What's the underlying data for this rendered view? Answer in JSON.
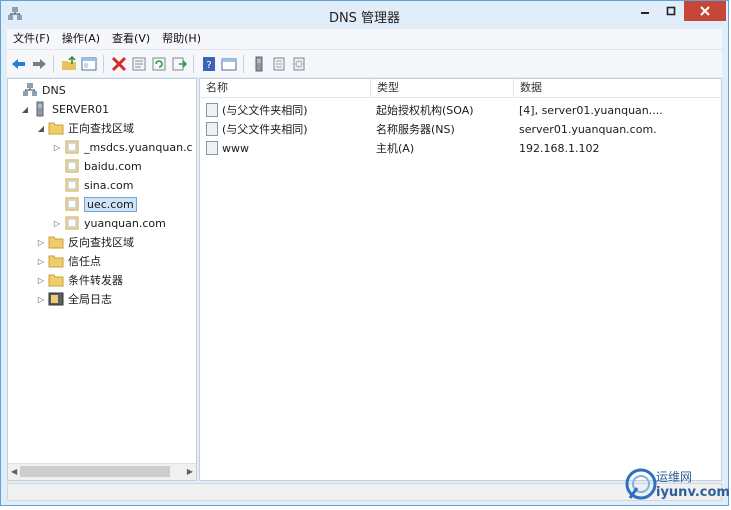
{
  "window": {
    "title": "DNS 管理器",
    "accent": "#c7463a"
  },
  "menu": [
    "文件(F)",
    "操作(A)",
    "查看(V)",
    "帮助(H)"
  ],
  "toolbar": {
    "icons": [
      "back-arrow-icon",
      "forward-arrow-icon",
      "up-folder-icon",
      "show-hide-tree-icon",
      "delete-icon",
      "properties-icon",
      "refresh-icon",
      "export-list-icon",
      "help-icon",
      "mmc-view-icon",
      "server-icon",
      "zone-record-icon",
      "doc-record-icon"
    ]
  },
  "tree": {
    "root": "DNS",
    "server": "SERVER01",
    "forward_zones": "正向查找区域",
    "zones": [
      "_msdcs.yuanquan.c",
      "baidu.com",
      "sina.com",
      "uec.com",
      "yuanquan.com"
    ],
    "selected": "uec.com",
    "reverse_zones": "反向查找区域",
    "trust_points": "信任点",
    "conditional_forwarders": "条件转发器",
    "global_logs": "全局日志"
  },
  "list": {
    "columns": [
      "名称",
      "类型",
      "数据"
    ],
    "rows": [
      {
        "name": "(与父文件夹相同)",
        "type": "起始授权机构(SOA)",
        "data": "[4], server01.yuanquan...."
      },
      {
        "name": "(与父文件夹相同)",
        "type": "名称服务器(NS)",
        "data": "server01.yuanquan.com."
      },
      {
        "name": "www",
        "type": "主机(A)",
        "data": "192.168.1.102"
      }
    ]
  },
  "watermark": {
    "line1": "运维网",
    "line2": "iyunv.com"
  }
}
